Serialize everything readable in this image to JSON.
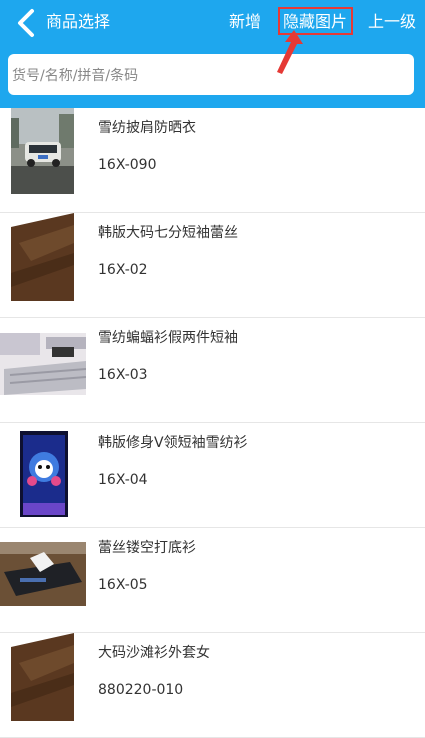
{
  "header": {
    "title": "商品选择",
    "actions": {
      "add": "新增",
      "hide_images": "隐藏图片",
      "up_level": "上一级"
    },
    "accent": "#1ea7ee"
  },
  "search": {
    "placeholder": "货号/名称/拼音/条码",
    "value": ""
  },
  "products": [
    {
      "name": "雪纺披肩防晒衣",
      "code": "16X-090",
      "image": "photo-car-street"
    },
    {
      "name": "韩版大码七分短袖蕾丝",
      "code": "16X-02",
      "image": "photo-wooden-table"
    },
    {
      "name": "雪纺蝙蝠衫假两件短袖",
      "code": "16X-03",
      "image": "photo-keyboard-desk"
    },
    {
      "name": "韩版修身V领短袖雪纺衫",
      "code": "16X-04",
      "image": "photo-cartoon-screen"
    },
    {
      "name": "蕾丝镂空打底衫",
      "code": "16X-05",
      "image": "photo-tissue-box"
    },
    {
      "name": "大码沙滩衫外套女",
      "code": "880220-010",
      "image": "photo-wooden-table"
    }
  ],
  "annotation_color": "#e53935"
}
